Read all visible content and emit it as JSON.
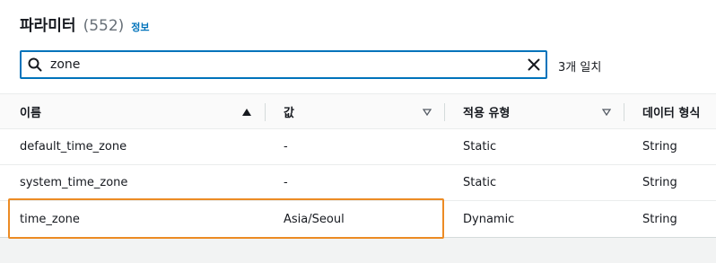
{
  "header": {
    "title": "파라미터",
    "count": "(552)",
    "info_link": "정보"
  },
  "search": {
    "value": "zone",
    "match_count": "3개 일치"
  },
  "table": {
    "columns": [
      {
        "label": "이름",
        "sort": "ascending"
      },
      {
        "label": "값",
        "sort": "none"
      },
      {
        "label": "적용 유형",
        "sort": "none"
      },
      {
        "label": "데이터 형식",
        "sort": "none"
      }
    ],
    "rows": [
      {
        "name": "default_time_zone",
        "value": "-",
        "apply_type": "Static",
        "data_type": "String"
      },
      {
        "name": "system_time_zone",
        "value": "-",
        "apply_type": "Static",
        "data_type": "String"
      },
      {
        "name": "time_zone",
        "value": "Asia/Seoul",
        "apply_type": "Dynamic",
        "data_type": "String"
      }
    ]
  },
  "colors": {
    "accent": "#0073bb",
    "highlight": "#ec8b24"
  }
}
